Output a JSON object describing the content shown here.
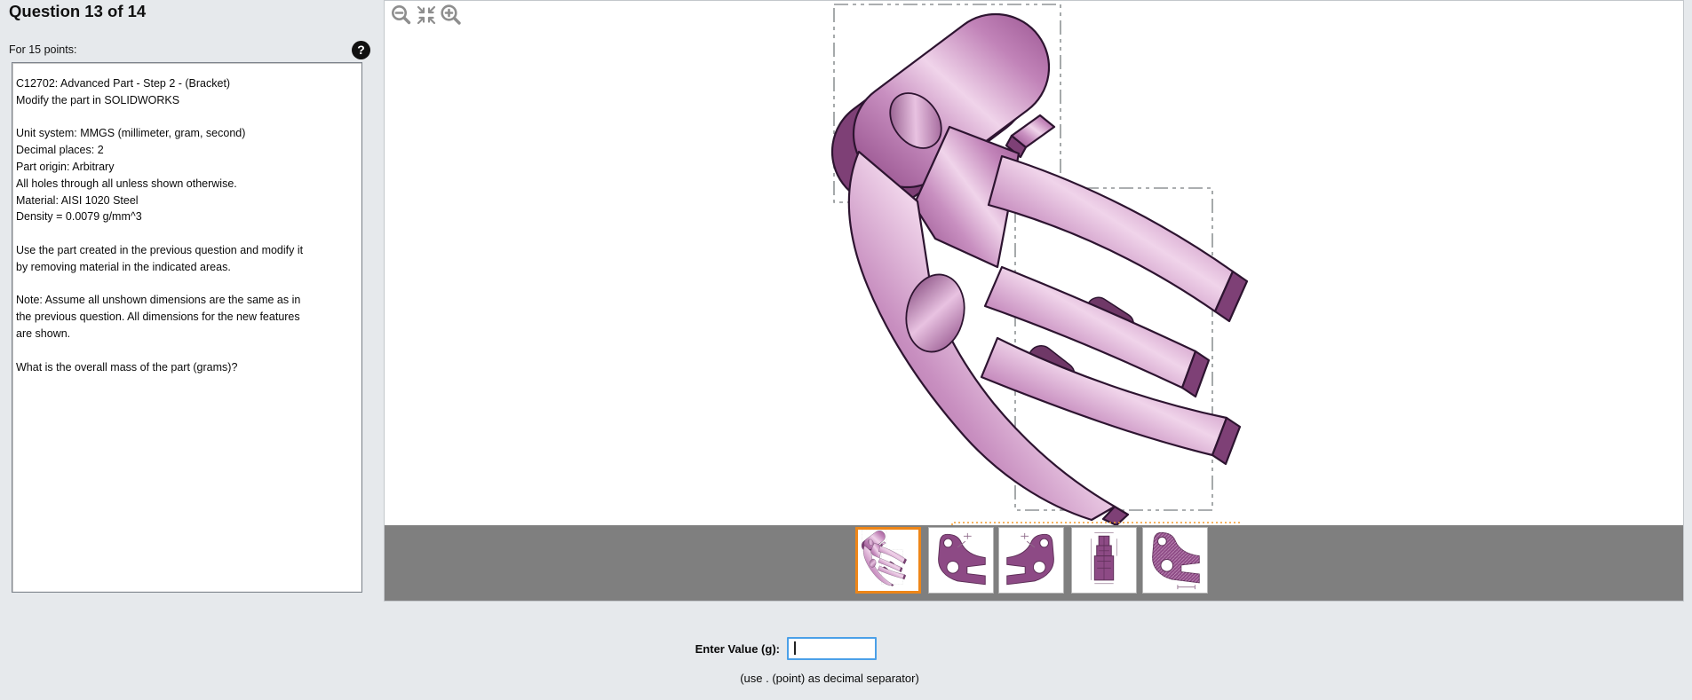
{
  "header": {
    "title": "Question 13 of 14",
    "points_label": "For 15 points:",
    "help_icon": "question-mark"
  },
  "question": {
    "lines": [
      "C12702:  Advanced Part - Step 2 - (Bracket)",
      "Modify the part in SOLIDWORKS",
      "",
      "Unit system: MMGS (millimeter, gram, second)",
      "Decimal places: 2",
      "Part origin: Arbitrary",
      "All holes through all unless shown otherwise.",
      "Material: AISI 1020 Steel",
      "Density = 0.0079 g/mm^3",
      "",
      "Use the part created in the previous question and modify it",
      "by removing material in the indicated areas.",
      "",
      "Note: Assume all unshown dimensions are the same as in",
      "the previous question.  All dimensions for the new features",
      "are shown.",
      "",
      "What is the overall mass of the part (grams)?"
    ]
  },
  "viewer": {
    "toolbar": {
      "icons": [
        "zoom-out-magnifier",
        "fit-to-view-arrows",
        "zoom-in-magnifier"
      ]
    },
    "model": "purple bracket with top lug hole, large body hole and two slotted fork arms",
    "thumbnails": [
      {
        "label": "isometric-3d-view",
        "selected": true
      },
      {
        "label": "side-view-drawing",
        "selected": false
      },
      {
        "label": "side-view-drawing-2",
        "selected": false
      },
      {
        "label": "front-view-drawing",
        "selected": false
      },
      {
        "label": "section-view-hatched",
        "selected": false
      }
    ],
    "colors": {
      "selection_orange": "#EE8618",
      "model_purple": "#9A5290",
      "strip_gray": "#7F7F7F",
      "focus_blue": "#4BA0E8"
    }
  },
  "answer": {
    "label": "Enter Value (g):",
    "input_value": "",
    "hint": "(use . (point) as decimal separator)"
  }
}
